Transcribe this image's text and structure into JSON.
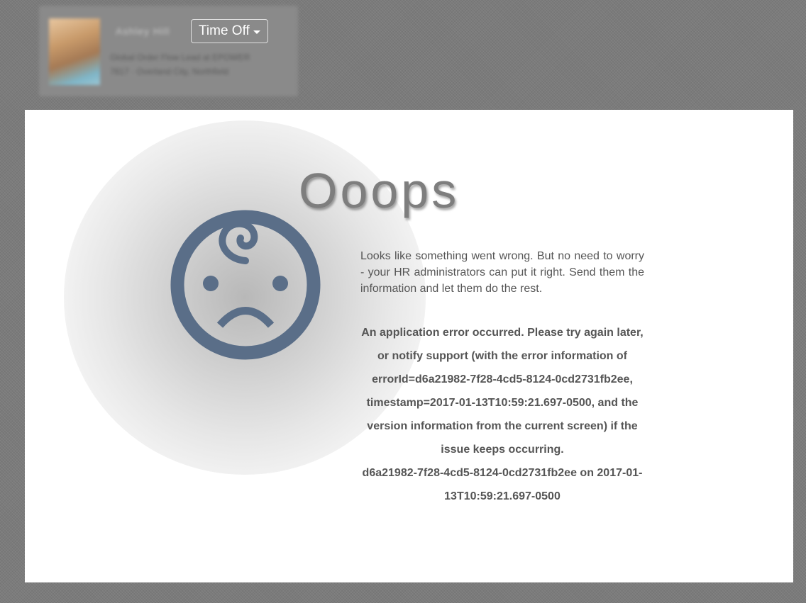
{
  "header": {
    "profile": {
      "name": "Ashley Hill",
      "line1": "Global Order Flow Lead at EPOWER",
      "line2": "7817 · Overland City, Northfield"
    },
    "menu_label": "Time Off",
    "icons": {
      "menu_caret": "chevron-down-icon",
      "error_face": "sad-face-icon"
    }
  },
  "error_page": {
    "title": "Ooops",
    "intro": "Looks like something went wrong. But no need to worry - your HR administrators can put it right. Send them the information and let them do the rest.",
    "message": "An application error occurred. Please try again later, or notify support (with the error information of errorId=d6a21982-7f28-4cd5-8124-0cd2731fb2ee, timestamp=2017-01-13T10:59:21.697-0500, and the version information from the current screen) if the issue keeps occurring.",
    "detail": "d6a21982-7f28-4cd5-8124-0cd2731fb2ee on 2017-01-13T10:59:21.697-0500"
  },
  "colors": {
    "background": "#7b7b7b",
    "panel": "#ffffff",
    "icon_blue": "#5a6e88",
    "title_gray": "#7e7e7e",
    "text_gray": "#555555"
  }
}
